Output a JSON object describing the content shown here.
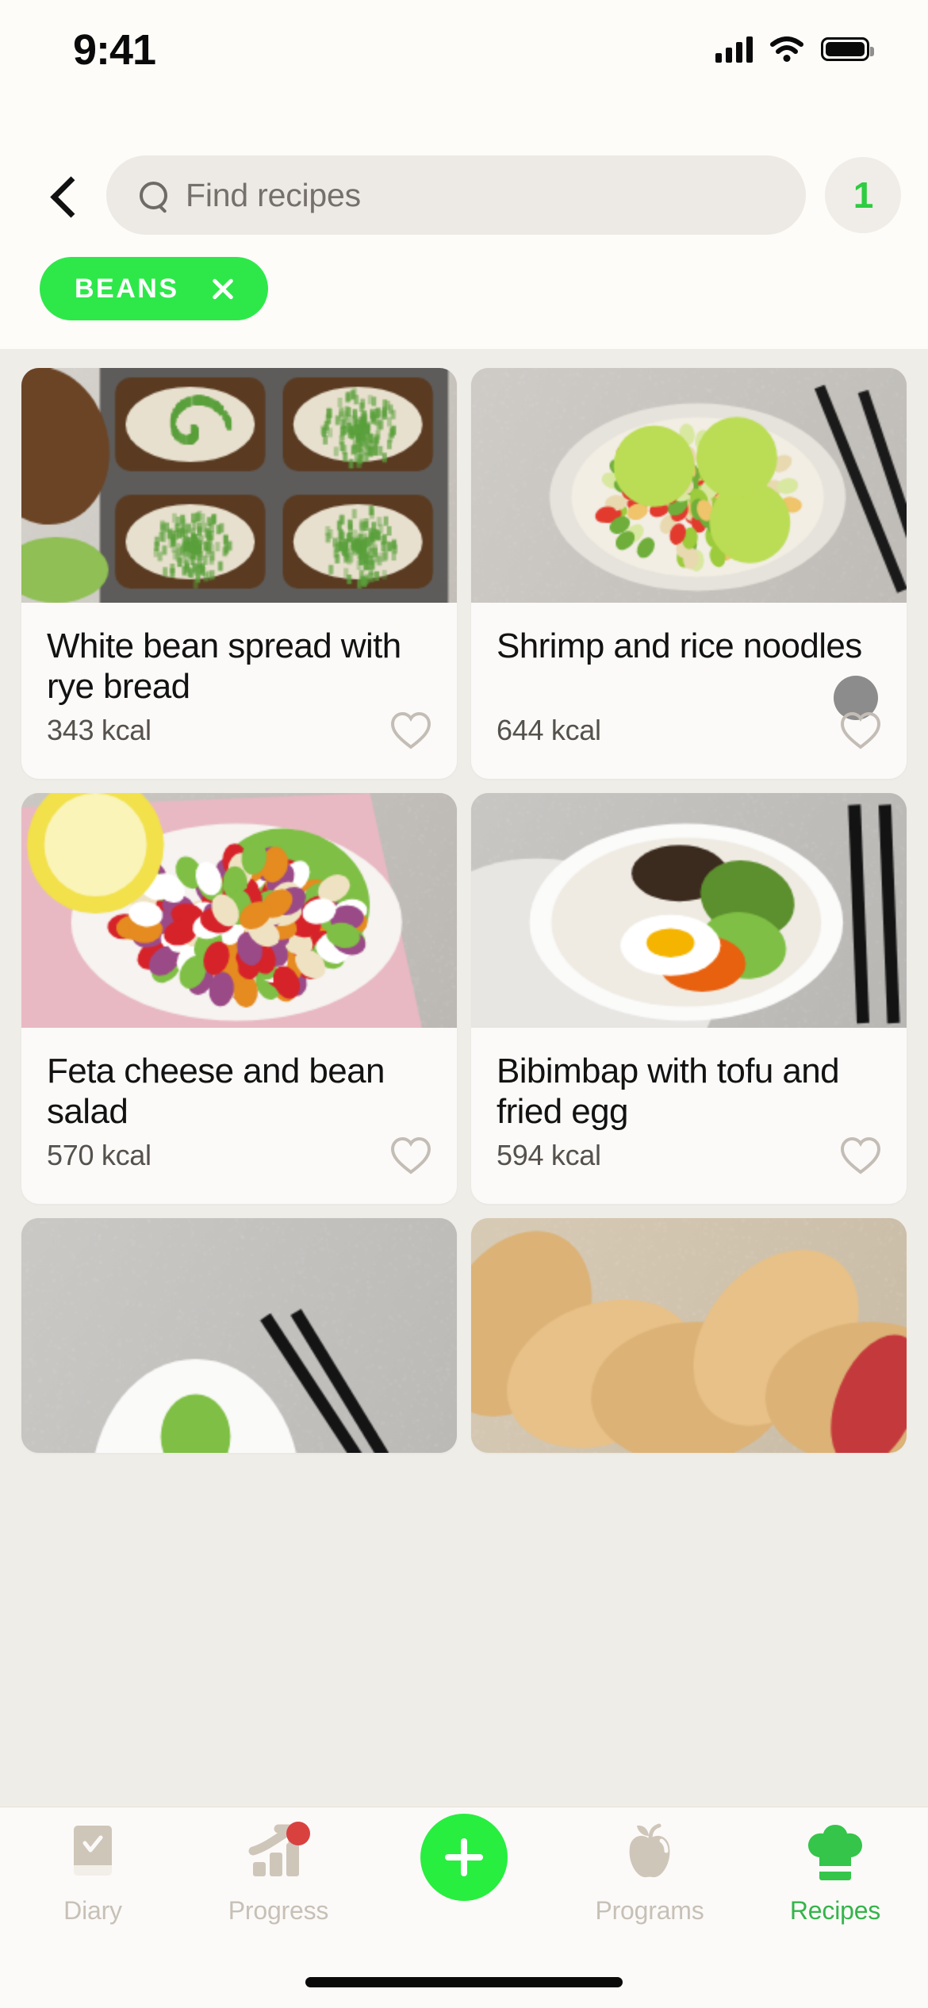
{
  "statusbar": {
    "time": "9:41",
    "cellular_icon": "cellular-signal-icon",
    "wifi_icon": "wifi-icon",
    "battery_icon": "battery-full-icon"
  },
  "header": {
    "back_icon": "chevron-left-icon",
    "search": {
      "placeholder": "Find recipes",
      "value": "",
      "icon": "search-icon"
    },
    "filter_badge": {
      "count": "1",
      "color": "#2ECC40"
    },
    "chips": [
      {
        "label": "BEANS",
        "remove_icon": "close-icon",
        "color": "#2EE84A"
      }
    ]
  },
  "recipes": [
    {
      "title": "White bean spread with rye bread",
      "kcal": "343 kcal",
      "favorite_icon": "heart-outline-icon",
      "image": "white-bean-spread-toast",
      "favorited": false,
      "touch_indicator": false
    },
    {
      "title": "Shrimp and rice noodles",
      "kcal": "644 kcal",
      "favorite_icon": "heart-outline-icon",
      "image": "shrimp-rice-noodle-soup",
      "favorited": false,
      "touch_indicator": true
    },
    {
      "title": "Feta cheese and bean salad",
      "kcal": "570 kcal",
      "favorite_icon": "heart-outline-icon",
      "image": "feta-bean-salad-bowl",
      "favorited": false,
      "touch_indicator": false
    },
    {
      "title": "Bibimbap with tofu and fried egg",
      "kcal": "594 kcal",
      "favorite_icon": "heart-outline-icon",
      "image": "bibimbap-tofu-egg-bowl",
      "favorited": false,
      "touch_indicator": false
    },
    {
      "title": "",
      "kcal": "",
      "favorite_icon": "heart-outline-icon",
      "image": "noodle-bowl-chopsticks",
      "favorited": false,
      "touch_indicator": false
    },
    {
      "title": "",
      "kcal": "",
      "favorite_icon": "heart-outline-icon",
      "image": "pastry-empanadas",
      "favorited": false,
      "touch_indicator": false
    }
  ],
  "tabbar": {
    "items": [
      {
        "label": "Diary",
        "icon": "diary-book-icon",
        "active": false,
        "badge": false
      },
      {
        "label": "Progress",
        "icon": "progress-chart-icon",
        "active": false,
        "badge": true
      },
      {
        "label": "",
        "icon": "add-plus-icon",
        "active": false,
        "badge": false
      },
      {
        "label": "Programs",
        "icon": "apple-icon",
        "active": false,
        "badge": false
      },
      {
        "label": "Recipes",
        "icon": "chef-hat-icon",
        "active": true,
        "badge": false
      }
    ],
    "active_color": "#35B44A",
    "inactive_color": "#C7C0B7",
    "fab_color": "#28EE3F",
    "badge_color": "#D9413F"
  },
  "home_indicator": "home-indicator-bar"
}
